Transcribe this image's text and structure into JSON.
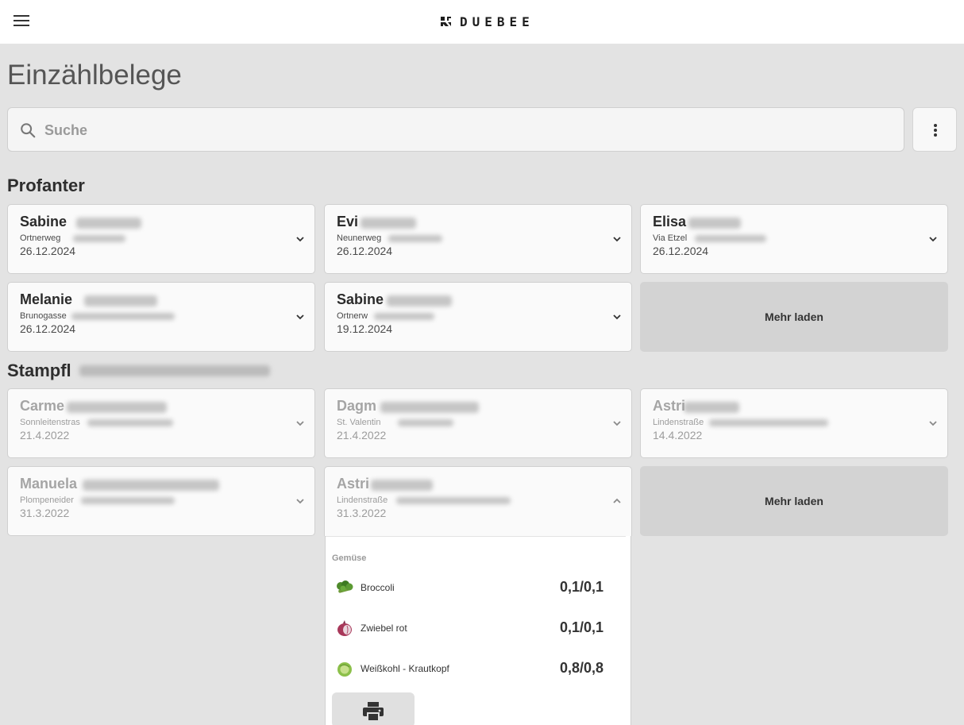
{
  "app": {
    "brand": "DUEBEE"
  },
  "page": {
    "title": "Einzählbelege"
  },
  "search": {
    "placeholder": "Suche",
    "value": ""
  },
  "groups": [
    {
      "title": "Profanter",
      "cards": [
        {
          "name": "Sabine",
          "address": "Ortnerweg",
          "date": "26.12.2024"
        },
        {
          "name": "Evi",
          "address": "Neunerweg",
          "date": "26.12.2024"
        },
        {
          "name": "Elisa",
          "address": "Via Etzel",
          "date": "26.12.2024"
        },
        {
          "name": "Melanie",
          "address": "Brunogasse",
          "date": "26.12.2024"
        },
        {
          "name": "Sabine",
          "address": "Ortnerw",
          "date": "19.12.2024"
        }
      ],
      "load_more": "Mehr laden"
    },
    {
      "title": "Stampfl",
      "cards": [
        {
          "name": "Carme",
          "address": "Sonnleitenstras",
          "date": "21.4.2022"
        },
        {
          "name": "Dagm",
          "address": "St. Valentin",
          "date": "21.4.2022"
        },
        {
          "name": "Astri",
          "address": "Lindenstraße",
          "date": "14.4.2022"
        },
        {
          "name": "Manuela",
          "address": "Plompeneider",
          "date": "31.3.2022"
        },
        {
          "name": "Astri",
          "address": "Lindenstraße",
          "date": "31.3.2022"
        }
      ],
      "load_more": "Mehr laden"
    }
  ],
  "expanded": {
    "category": "Gemüse",
    "items": [
      {
        "name": "Broccoli",
        "quantity": "0,1/0,1",
        "icon": "broccoli-icon"
      },
      {
        "name": "Zwiebel rot",
        "quantity": "0,1/0,1",
        "icon": "red-onion-icon"
      },
      {
        "name": "Weißkohl - Krautkopf",
        "quantity": "0,8/0,8",
        "icon": "cabbage-icon"
      }
    ]
  }
}
